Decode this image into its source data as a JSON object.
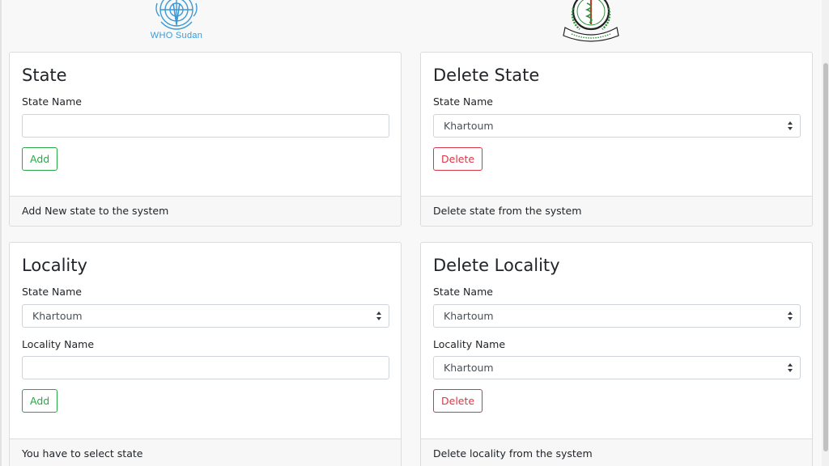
{
  "logos": {
    "who_text": "WHO Sudan"
  },
  "state_card": {
    "title": "State",
    "state_name_label": "State Name",
    "state_name_value": "",
    "add_label": "Add",
    "footer": "Add New state to the system"
  },
  "delete_state_card": {
    "title": "Delete State",
    "state_name_label": "State Name",
    "state_selected": "Khartoum",
    "delete_label": "Delete",
    "footer": "Delete state from the system"
  },
  "locality_card": {
    "title": "Locality",
    "state_name_label": "State Name",
    "state_selected": "Khartoum",
    "locality_name_label": "Locality Name",
    "locality_name_value": "",
    "add_label": "Add",
    "footer": "You have to select state"
  },
  "delete_locality_card": {
    "title": "Delete Locality",
    "state_name_label": "State Name",
    "state_selected": "Khartoum",
    "locality_name_label": "Locality Name",
    "locality_selected": "Khartoum",
    "delete_label": "Delete",
    "footer": "Delete locality from the system"
  },
  "colors": {
    "success": "#28a745",
    "danger": "#dc3545",
    "who_blue": "#3b9ad6"
  }
}
